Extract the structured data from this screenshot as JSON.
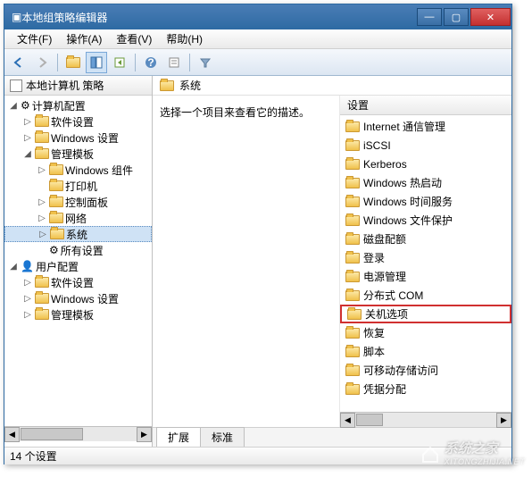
{
  "window": {
    "title": "本地组策略编辑器"
  },
  "menu": {
    "file": "文件(F)",
    "action": "操作(A)",
    "view": "查看(V)",
    "help": "帮助(H)"
  },
  "tree": {
    "root": "本地计算机 策略",
    "computer_config": "计算机配置",
    "software_settings": "软件设置",
    "windows_settings": "Windows 设置",
    "admin_templates": "管理模板",
    "windows_components": "Windows 组件",
    "printers": "打印机",
    "control_panel": "控制面板",
    "network": "网络",
    "system": "系统",
    "all_settings": "所有设置",
    "user_config": "用户配置",
    "u_software": "软件设置",
    "u_windows": "Windows 设置",
    "u_admin": "管理模板"
  },
  "location": {
    "current": "系统"
  },
  "desc": {
    "prompt": "选择一个项目来查看它的描述。"
  },
  "listheader": {
    "setting": "设置"
  },
  "items": {
    "0": "Internet 通信管理",
    "1": "iSCSI",
    "2": "Kerberos",
    "3": "Windows 热启动",
    "4": "Windows 时间服务",
    "5": "Windows 文件保护",
    "6": "磁盘配额",
    "7": "登录",
    "8": "电源管理",
    "9": "分布式 COM",
    "10": "关机选项",
    "11": "恢复",
    "12": "脚本",
    "13": "可移动存储访问",
    "14": "凭据分配"
  },
  "tabs": {
    "extended": "扩展",
    "standard": "标准"
  },
  "status": {
    "count": "14 个设置"
  },
  "watermark": {
    "text": "系统之家",
    "url": "XITONGZHIJIA.NET"
  }
}
